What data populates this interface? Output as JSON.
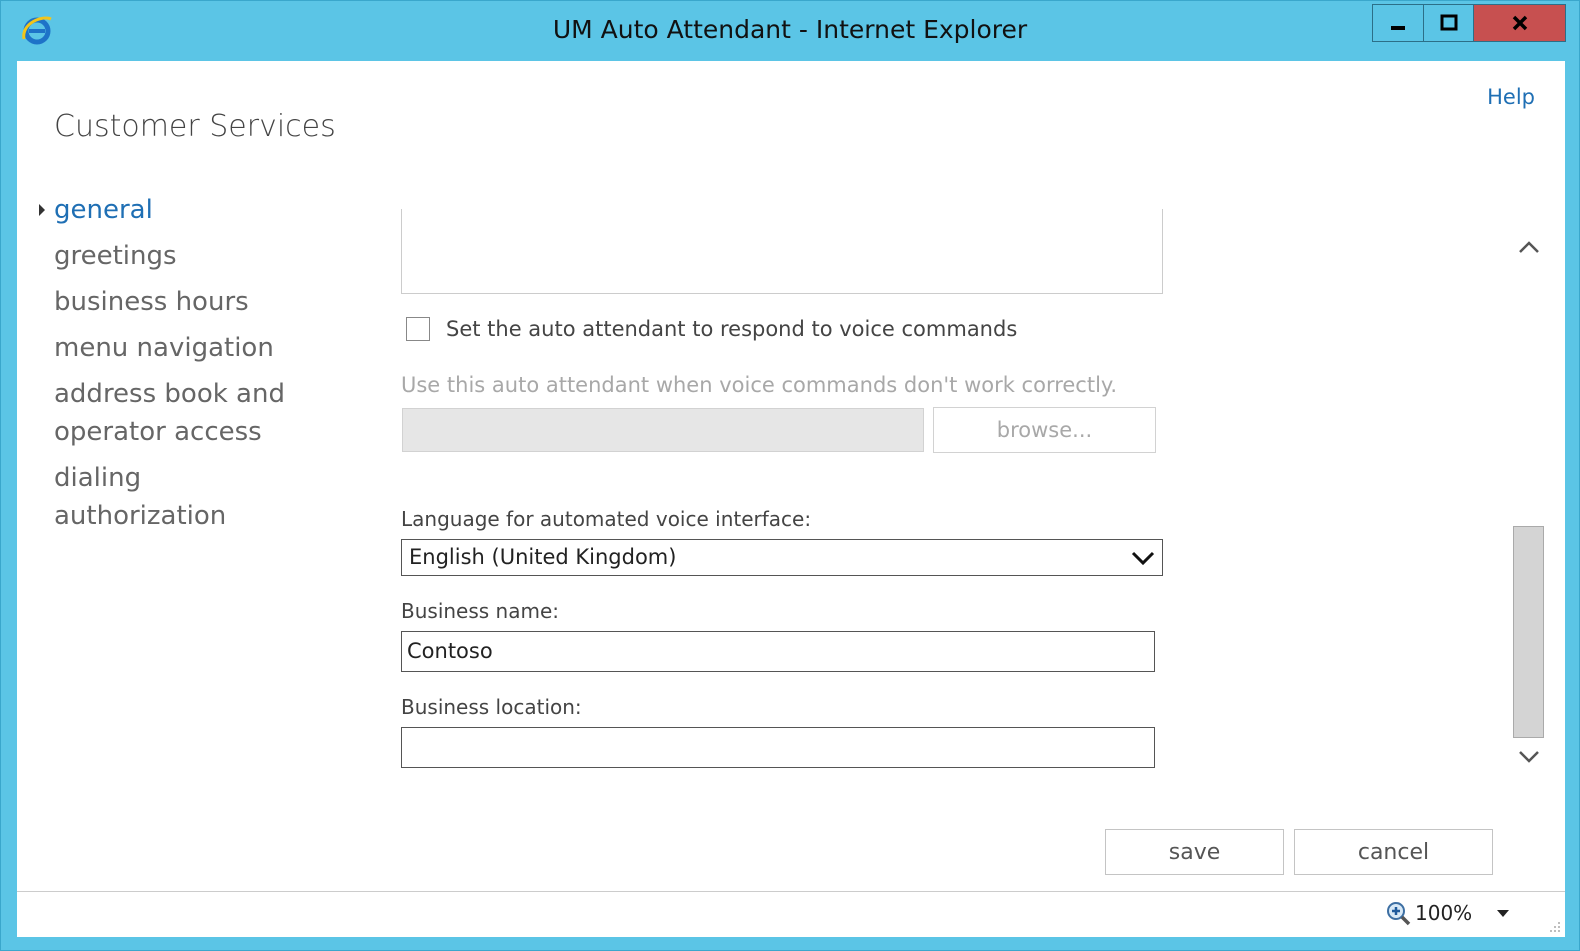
{
  "window": {
    "title": "UM Auto Attendant - Internet Explorer",
    "accent_color": "#5bc5e6",
    "close_color": "#c75050"
  },
  "header": {
    "help_label": "Help",
    "page_title": "Customer Services"
  },
  "nav": {
    "items": [
      {
        "label": "general",
        "active": true
      },
      {
        "label": "greetings",
        "active": false
      },
      {
        "label": "business hours",
        "active": false
      },
      {
        "label": "menu navigation",
        "active": false
      },
      {
        "label": "address book and operator access",
        "active": false
      },
      {
        "label": "dialing authorization",
        "active": false
      }
    ]
  },
  "form": {
    "voice_commands_checkbox_label": "Set the auto attendant to respond to voice commands",
    "voice_commands_checked": false,
    "fallback_hint": "Use this auto attendant when voice commands don't work correctly.",
    "fallback_value": "",
    "browse_label": "browse...",
    "language_label": "Language for automated voice interface:",
    "language_value": "English (United Kingdom)",
    "business_name_label": "Business name:",
    "business_name_value": "Contoso",
    "business_location_label": "Business location:",
    "business_location_value": ""
  },
  "actions": {
    "save_label": "save",
    "cancel_label": "cancel"
  },
  "statusbar": {
    "zoom": "100%"
  }
}
